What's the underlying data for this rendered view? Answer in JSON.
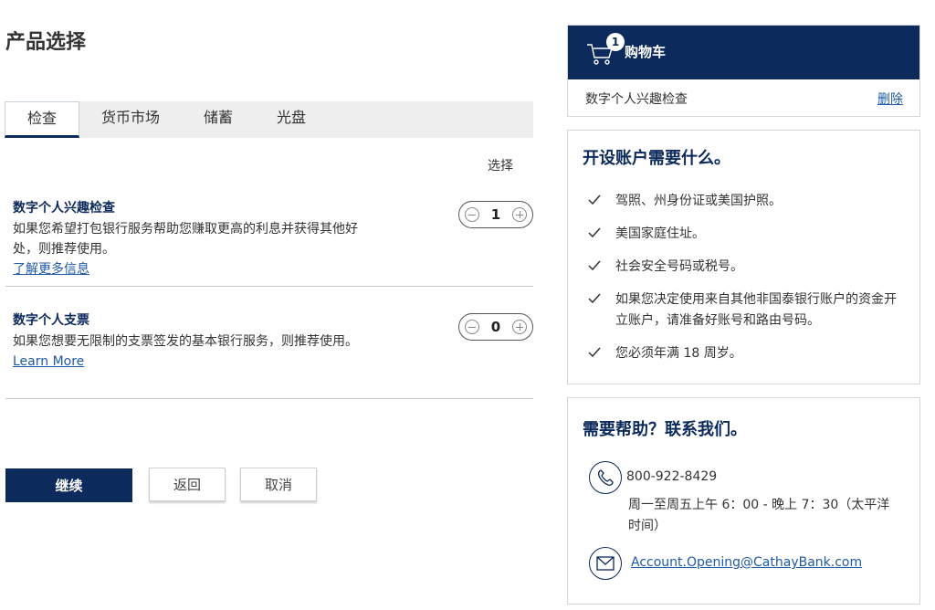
{
  "page": {
    "title": "产品选择"
  },
  "tabs": [
    {
      "label": "检查"
    },
    {
      "label": "货币市场"
    },
    {
      "label": "储蓄"
    },
    {
      "label": "光盘"
    }
  ],
  "selection_header": "选择",
  "products": [
    {
      "name": "数字个人兴趣检查",
      "description": "如果您希望打包银行服务帮助您赚取更高的利息并获得其他好处，则推荐使用。",
      "more_link": "了解更多信息",
      "quantity": "1"
    },
    {
      "name": "数字个人支票",
      "description": "如果您想要无限制的支票签发的基本银行服务，则推荐使用。",
      "more_link": "Learn More",
      "quantity": "0"
    }
  ],
  "actions": {
    "continue": "继续",
    "back": "返回",
    "cancel": "取消"
  },
  "cart": {
    "badge": "1",
    "title": "购物车",
    "item": "数字个人兴趣检查",
    "remove": "删除"
  },
  "requirements": {
    "title": "开设账户需要什么。",
    "items": [
      "驾照、州身份证或美国护照。",
      "美国家庭住址。",
      "社会安全号码或税号。",
      "如果您决定使用来自其他非国泰银行账户的资金开立账户，请准备好账号和路由号码。",
      "您必须年满 18 周岁。"
    ]
  },
  "help": {
    "title": "需要帮助？联系我们。",
    "phone": "800-922-8429",
    "hours": "周一至周五上午 6：00 - 晚上 7：30（太平洋时间）",
    "email": "Account.Opening@CathayBank.com"
  },
  "colors": {
    "brand_navy": "#0c2a5b",
    "link": "#1f5aa6"
  }
}
